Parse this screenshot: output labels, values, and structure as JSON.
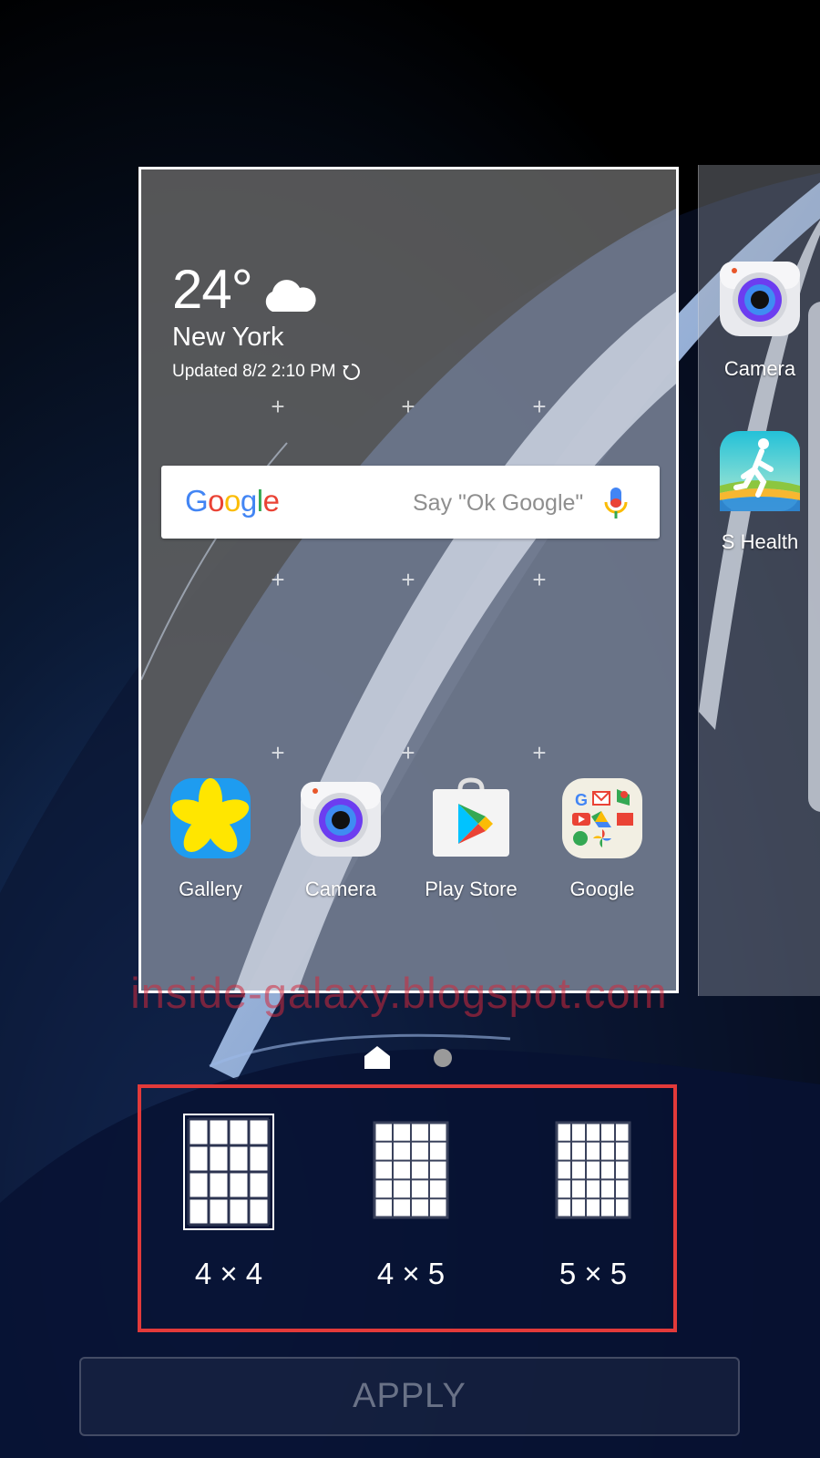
{
  "weather": {
    "temperature": "24°",
    "city": "New York",
    "updated": "Updated 8/2 2:10 PM",
    "condition_icon": "cloud-icon",
    "refresh_icon": "refresh-icon"
  },
  "search": {
    "logo": "Google",
    "hint": "Say \"Ok Google\"",
    "mic_icon": "microphone-icon"
  },
  "apps": [
    {
      "label": "Gallery",
      "icon": "gallery-icon"
    },
    {
      "label": "Camera",
      "icon": "camera-icon"
    },
    {
      "label": "Play Store",
      "icon": "play-store-icon"
    },
    {
      "label": "Google",
      "icon": "google-folder-icon"
    }
  ],
  "next_page_apps": [
    {
      "label": "Camera",
      "icon": "camera-icon"
    },
    {
      "label": "S Health",
      "icon": "s-health-icon"
    }
  ],
  "watermark": "inside-galaxy.blogspot.com",
  "page_indicators": [
    "home-indicator-icon",
    "page-dot-icon"
  ],
  "grid_options": [
    {
      "label": "4 × 4",
      "selected": true
    },
    {
      "label": "4 × 5",
      "selected": false
    },
    {
      "label": "5 × 5",
      "selected": false
    }
  ],
  "apply_label": "APPLY",
  "colors": {
    "highlight_border": "#e23a3a",
    "google_blue": "#4285F4",
    "google_red": "#EA4335",
    "google_yellow": "#FBBC05",
    "google_green": "#34A853"
  }
}
